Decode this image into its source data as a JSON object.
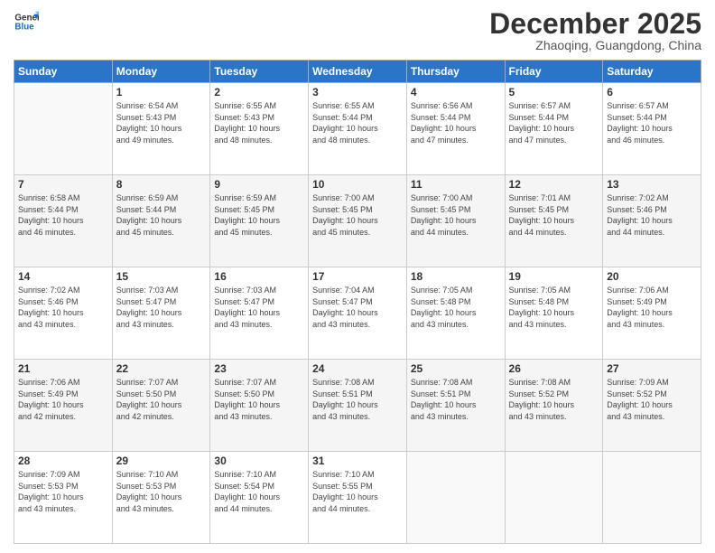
{
  "logo": {
    "line1": "General",
    "line2": "Blue"
  },
  "title": "December 2025",
  "subtitle": "Zhaoqing, Guangdong, China",
  "days_of_week": [
    "Sunday",
    "Monday",
    "Tuesday",
    "Wednesday",
    "Thursday",
    "Friday",
    "Saturday"
  ],
  "weeks": [
    [
      {
        "day": "",
        "info": ""
      },
      {
        "day": "1",
        "info": "Sunrise: 6:54 AM\nSunset: 5:43 PM\nDaylight: 10 hours\nand 49 minutes."
      },
      {
        "day": "2",
        "info": "Sunrise: 6:55 AM\nSunset: 5:43 PM\nDaylight: 10 hours\nand 48 minutes."
      },
      {
        "day": "3",
        "info": "Sunrise: 6:55 AM\nSunset: 5:44 PM\nDaylight: 10 hours\nand 48 minutes."
      },
      {
        "day": "4",
        "info": "Sunrise: 6:56 AM\nSunset: 5:44 PM\nDaylight: 10 hours\nand 47 minutes."
      },
      {
        "day": "5",
        "info": "Sunrise: 6:57 AM\nSunset: 5:44 PM\nDaylight: 10 hours\nand 47 minutes."
      },
      {
        "day": "6",
        "info": "Sunrise: 6:57 AM\nSunset: 5:44 PM\nDaylight: 10 hours\nand 46 minutes."
      }
    ],
    [
      {
        "day": "7",
        "info": "Sunrise: 6:58 AM\nSunset: 5:44 PM\nDaylight: 10 hours\nand 46 minutes."
      },
      {
        "day": "8",
        "info": "Sunrise: 6:59 AM\nSunset: 5:44 PM\nDaylight: 10 hours\nand 45 minutes."
      },
      {
        "day": "9",
        "info": "Sunrise: 6:59 AM\nSunset: 5:45 PM\nDaylight: 10 hours\nand 45 minutes."
      },
      {
        "day": "10",
        "info": "Sunrise: 7:00 AM\nSunset: 5:45 PM\nDaylight: 10 hours\nand 45 minutes."
      },
      {
        "day": "11",
        "info": "Sunrise: 7:00 AM\nSunset: 5:45 PM\nDaylight: 10 hours\nand 44 minutes."
      },
      {
        "day": "12",
        "info": "Sunrise: 7:01 AM\nSunset: 5:45 PM\nDaylight: 10 hours\nand 44 minutes."
      },
      {
        "day": "13",
        "info": "Sunrise: 7:02 AM\nSunset: 5:46 PM\nDaylight: 10 hours\nand 44 minutes."
      }
    ],
    [
      {
        "day": "14",
        "info": "Sunrise: 7:02 AM\nSunset: 5:46 PM\nDaylight: 10 hours\nand 43 minutes."
      },
      {
        "day": "15",
        "info": "Sunrise: 7:03 AM\nSunset: 5:47 PM\nDaylight: 10 hours\nand 43 minutes."
      },
      {
        "day": "16",
        "info": "Sunrise: 7:03 AM\nSunset: 5:47 PM\nDaylight: 10 hours\nand 43 minutes."
      },
      {
        "day": "17",
        "info": "Sunrise: 7:04 AM\nSunset: 5:47 PM\nDaylight: 10 hours\nand 43 minutes."
      },
      {
        "day": "18",
        "info": "Sunrise: 7:05 AM\nSunset: 5:48 PM\nDaylight: 10 hours\nand 43 minutes."
      },
      {
        "day": "19",
        "info": "Sunrise: 7:05 AM\nSunset: 5:48 PM\nDaylight: 10 hours\nand 43 minutes."
      },
      {
        "day": "20",
        "info": "Sunrise: 7:06 AM\nSunset: 5:49 PM\nDaylight: 10 hours\nand 43 minutes."
      }
    ],
    [
      {
        "day": "21",
        "info": "Sunrise: 7:06 AM\nSunset: 5:49 PM\nDaylight: 10 hours\nand 42 minutes."
      },
      {
        "day": "22",
        "info": "Sunrise: 7:07 AM\nSunset: 5:50 PM\nDaylight: 10 hours\nand 42 minutes."
      },
      {
        "day": "23",
        "info": "Sunrise: 7:07 AM\nSunset: 5:50 PM\nDaylight: 10 hours\nand 43 minutes."
      },
      {
        "day": "24",
        "info": "Sunrise: 7:08 AM\nSunset: 5:51 PM\nDaylight: 10 hours\nand 43 minutes."
      },
      {
        "day": "25",
        "info": "Sunrise: 7:08 AM\nSunset: 5:51 PM\nDaylight: 10 hours\nand 43 minutes."
      },
      {
        "day": "26",
        "info": "Sunrise: 7:08 AM\nSunset: 5:52 PM\nDaylight: 10 hours\nand 43 minutes."
      },
      {
        "day": "27",
        "info": "Sunrise: 7:09 AM\nSunset: 5:52 PM\nDaylight: 10 hours\nand 43 minutes."
      }
    ],
    [
      {
        "day": "28",
        "info": "Sunrise: 7:09 AM\nSunset: 5:53 PM\nDaylight: 10 hours\nand 43 minutes."
      },
      {
        "day": "29",
        "info": "Sunrise: 7:10 AM\nSunset: 5:53 PM\nDaylight: 10 hours\nand 43 minutes."
      },
      {
        "day": "30",
        "info": "Sunrise: 7:10 AM\nSunset: 5:54 PM\nDaylight: 10 hours\nand 44 minutes."
      },
      {
        "day": "31",
        "info": "Sunrise: 7:10 AM\nSunset: 5:55 PM\nDaylight: 10 hours\nand 44 minutes."
      },
      {
        "day": "",
        "info": ""
      },
      {
        "day": "",
        "info": ""
      },
      {
        "day": "",
        "info": ""
      }
    ]
  ]
}
